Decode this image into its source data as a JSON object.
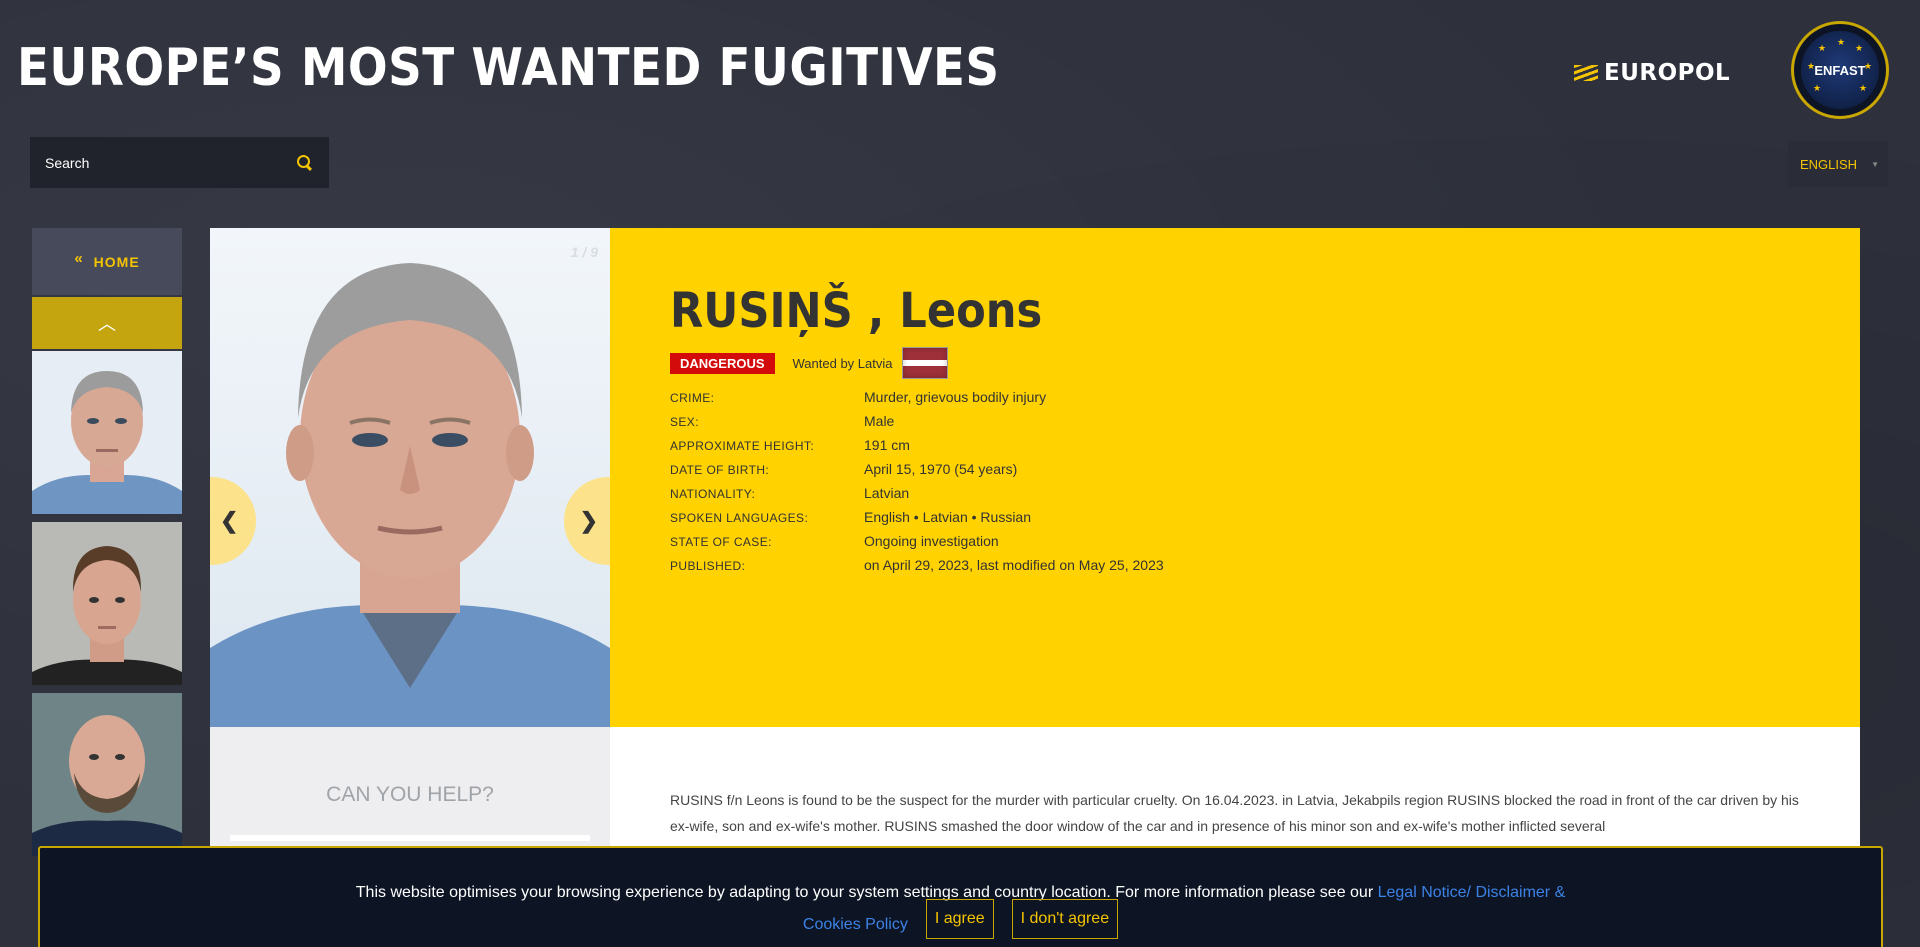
{
  "header": {
    "site_title": "EUROPE’S MOST WANTED FUGITIVES",
    "europol_logo": "EUROPOL",
    "enfast_logo": "ENFAST"
  },
  "search": {
    "placeholder": "Search"
  },
  "language": {
    "selected": "ENGLISH"
  },
  "sidebar": {
    "home_label": "HOME",
    "home_icon": "double-chevron-left-icon",
    "up_icon": "chevron-up-icon"
  },
  "profile": {
    "counter": "1 / 9",
    "name": "RUSIŅŠ , Leons",
    "danger_badge": "DANGEROUS",
    "wanted_by": "Wanted by Latvia",
    "details": [
      {
        "label": "CRIME:",
        "value": "Murder, grievous bodily injury"
      },
      {
        "label": "SEX:",
        "value": "Male"
      },
      {
        "label": "APPROXIMATE HEIGHT:",
        "value": "191 cm"
      },
      {
        "label": "DATE OF BIRTH:",
        "value": "April 15, 1970 (54 years)"
      },
      {
        "label": "NATIONALITY:",
        "value": "Latvian"
      },
      {
        "label": "SPOKEN LANGUAGES:",
        "value": "English • Latvian • Russian"
      },
      {
        "label": "STATE OF CASE:",
        "value": "Ongoing investigation"
      },
      {
        "label": "PUBLISHED:",
        "value": "on April 29, 2023, last modified on May 25, 2023"
      }
    ],
    "prev_arrow": "❮",
    "next_arrow": "❯"
  },
  "help": {
    "title": "CAN YOU HELP?"
  },
  "description": "RUSINS f/n Leons is found to be the suspect for the murder with particular cruelty. On 16.04.2023. in Latvia, Jekabpils region RUSINS blocked the road in front of the car driven by his ex-wife, son and ex-wife's mother. RUSINS smashed the door window of the car and in presence of his minor son and ex-wife's mother inflicted several",
  "cookie": {
    "text": "This website optimises your browsing experience by adapting to your system settings and country location. For more information please see our",
    "link": "Legal Notice/ Disclaimer & Cookies Policy",
    "agree": "I agree",
    "disagree": "I don't agree"
  },
  "colors": {
    "accent_yellow": "#ffd200",
    "danger_red": "#d40b0b",
    "background": "#2e313c"
  }
}
